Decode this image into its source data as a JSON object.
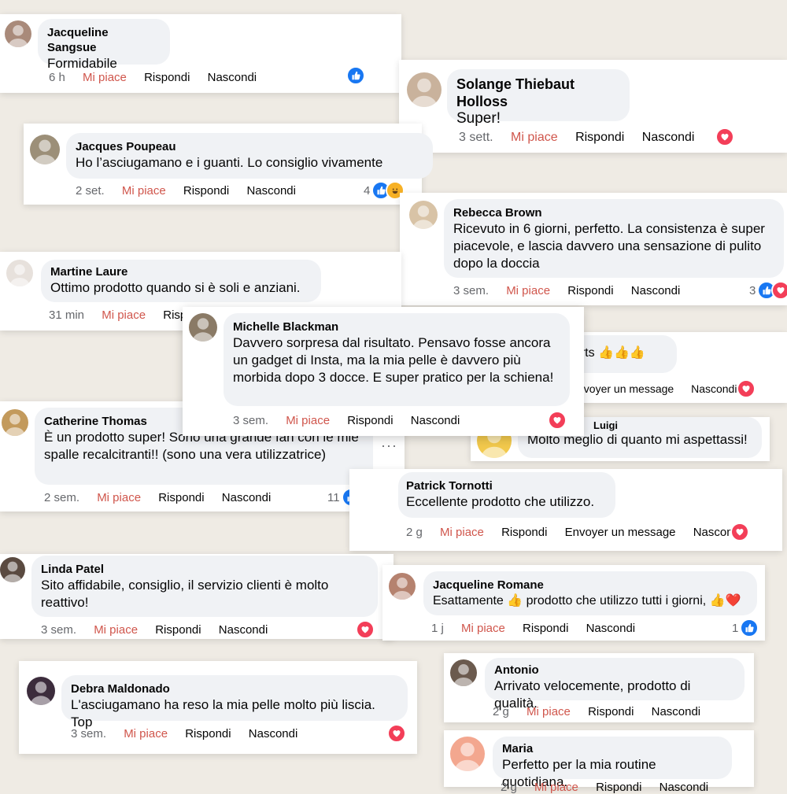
{
  "colors": {
    "like_blue": "#1877f2",
    "love_red": "#f33e58",
    "mi_piace": "#d0564c",
    "bubble": "#f0f2f5"
  },
  "comments": [
    {
      "name": "Jacqueline Sangsue",
      "text": "Formidabile",
      "time": "6 h",
      "like": "Mi piace",
      "reply": "Rispondi",
      "hide": "Nascondi",
      "reactions": [
        "like-icon"
      ],
      "count": ""
    },
    {
      "name": "Solange Thiebaut Holloss",
      "text": "Super!",
      "time": "3 sett.",
      "like": "Mi piace",
      "reply": "Rispondi",
      "hide": "Nascondi",
      "reactions": [
        "love-icon"
      ],
      "count": ""
    },
    {
      "name": "Jacques Poupeau",
      "text": "Ho l’asciugamano e i guanti. Lo consiglio vivamente",
      "time": "2 set.",
      "like": "Mi piace",
      "reply": "Rispondi",
      "hide": "Nascondi",
      "reactions": [
        "like-icon",
        "haha-icon"
      ],
      "count": "4"
    },
    {
      "name": "Rebecca Brown",
      "text": "Ricevuto in 6 giorni, perfetto. La consistenza è super piacevole, e lascia davvero una sensazione di pulito dopo la doccia",
      "time": "3 sem.",
      "like": "Mi piace",
      "reply": "Rispondi",
      "hide": "Nascondi",
      "reactions": [
        "like-icon",
        "love-icon"
      ],
      "count": "3"
    },
    {
      "name": "Martine Laure",
      "text": "Ottimo prodotto quando si è soli e anziani.",
      "time": "31 min",
      "like": "Mi piace",
      "reply": "Rispo",
      "hide": "",
      "reactions": [],
      "count": ""
    },
    {
      "name": "Michelle Blackman",
      "text": "Davvero sorpresa dal risultato. Pensavo fosse ancora un gadget di Insta, ma la mia pelle è davvero più morbida dopo 3 docce. E super pratico per la schiena!",
      "time": "3 sem.",
      "like": "Mi piace",
      "reply": "Rispondi",
      "hide": "Nascondi",
      "reactions": [
        "love-icon"
      ],
      "count": ""
    },
    {
      "name": "",
      "text": "courts 👍👍👍",
      "time": "",
      "like": "",
      "reply": "nvoyer un message",
      "hide": "Nascondi",
      "reactions": [
        "love-icon"
      ],
      "count": ""
    },
    {
      "name": "Catherine Thomas",
      "text": "È un prodotto super! Sono una grande fan con le mie spalle recalcitranti!! (sono una vera utilizzatrice)",
      "time": "2 sem.",
      "like": "Mi piace",
      "reply": "Rispondi",
      "hide": "Nascondi",
      "reactions": [
        "like-icon",
        "love-icon"
      ],
      "count": "11"
    },
    {
      "name": "Luigi",
      "text": "Molto meglio di quanto mi aspettassi!",
      "time": "",
      "like": "",
      "reply": "",
      "hide": "",
      "reactions": [],
      "count": ""
    },
    {
      "name": "Patrick Tornotti",
      "text": "Eccellente prodotto che utilizzo.",
      "time": "2 g",
      "like": "Mi piace",
      "reply": "Rispondi",
      "message": "Envoyer un message",
      "hide": "Nascondi",
      "reactions": [
        "love-icon"
      ],
      "count": ""
    },
    {
      "name": "Linda Patel",
      "text": "Sito affidabile, consiglio, il servizio clienti è molto reattivo!",
      "time": "3 sem.",
      "like": "Mi piace",
      "reply": "Rispondi",
      "hide": "Nascondi",
      "reactions": [
        "love-icon"
      ],
      "count": ""
    },
    {
      "name": "Jacqueline Romane",
      "text": "Esattamente 👍 prodotto che utilizzo tutti i giorni, 👍❤️",
      "time": "1 j",
      "like": "Mi piace",
      "reply": "Rispondi",
      "hide": "Nascondi",
      "reactions": [
        "like-icon"
      ],
      "count": "1"
    },
    {
      "name": "Debra Maldonado",
      "text": "L'asciugamano ha reso la mia pelle molto più liscia. Top",
      "time": "3 sem.",
      "like": "Mi piace",
      "reply": "Rispondi",
      "hide": "Nascondi",
      "reactions": [
        "love-icon"
      ],
      "count": ""
    },
    {
      "name": "Antonio",
      "text": "Arrivato velocemente, prodotto di qualità.",
      "time": "2 g",
      "like": "Mi piace",
      "reply": "Rispondi",
      "hide": "Nascondi",
      "reactions": [],
      "count": ""
    },
    {
      "name": "Maria",
      "text": "Perfetto per la mia routine quotidiana.",
      "time": "2 g",
      "like": "Mi piace",
      "reply": "Rispondi",
      "hide": "Nascondi",
      "reactions": [],
      "count": ""
    }
  ],
  "more_menu": "···"
}
